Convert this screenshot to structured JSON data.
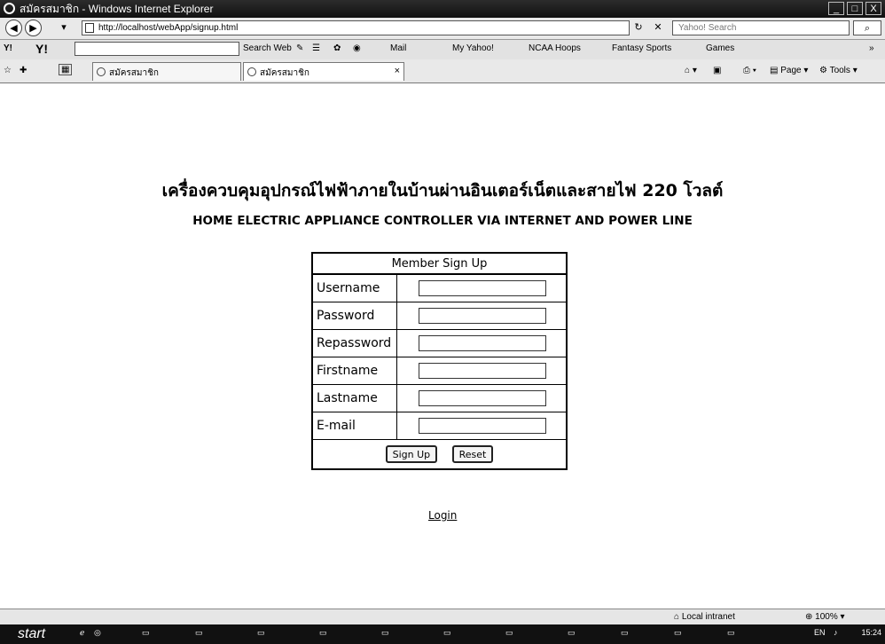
{
  "window": {
    "title": "สมัครสมาชิก - Windows Internet Explorer",
    "controls": [
      "_",
      "□",
      "X"
    ]
  },
  "address": {
    "url": "http://localhost/webApp/signup.html",
    "search_placeholder": "Yahoo! Search"
  },
  "yahoo_toolbar": {
    "search_web": "Search Web",
    "items": [
      "Mail",
      "My Yahoo!",
      "NCAA Hoops",
      "Fantasy Sports",
      "Games"
    ]
  },
  "tabs": [
    {
      "label": "สมัครสมาชิก"
    },
    {
      "label": "สมัครสมาชิก"
    }
  ],
  "command_bar": {
    "page": "Page",
    "tools": "Tools"
  },
  "page": {
    "thai_title": "เครื่องควบคุมอุปกรณ์ไฟฟ้าภายในบ้านผ่านอินเตอร์เน็ตและสายไฟ 220 โวลต์",
    "english_title": "HOME ELECTRIC APPLIANCE CONTROLLER VIA INTERNET AND POWER LINE",
    "form": {
      "heading": "Member Sign Up",
      "fields": {
        "username": {
          "label": "Username",
          "value": ""
        },
        "password": {
          "label": "Password",
          "value": ""
        },
        "repassword": {
          "label": "Repassword",
          "value": ""
        },
        "firstname": {
          "label": "Firstname",
          "value": ""
        },
        "lastname": {
          "label": "Lastname",
          "value": ""
        },
        "email": {
          "label": "E-mail",
          "value": ""
        }
      },
      "signup_button": "Sign Up",
      "reset_button": "Reset"
    },
    "login_link": "Login"
  },
  "status": {
    "zone": "Local intranet",
    "zoom": "100%"
  },
  "taskbar": {
    "start": "start",
    "clock": "15:24",
    "lang": "EN"
  }
}
